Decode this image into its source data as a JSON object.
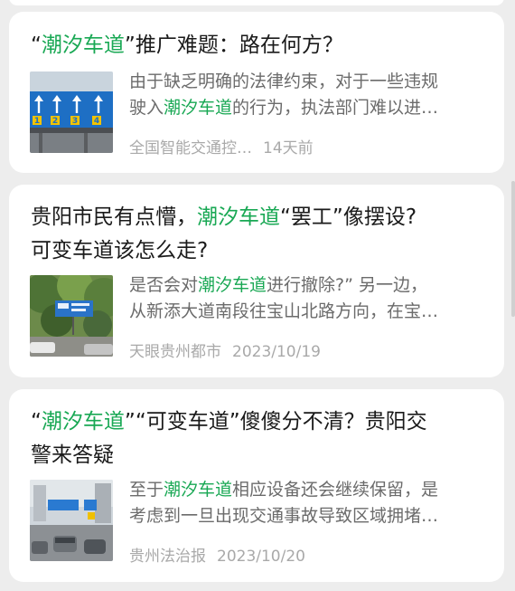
{
  "articles": [
    {
      "title": {
        "pre": "“",
        "hl": "潮汐车道",
        "post": "”推广难题：路在何方？",
        "line2": ""
      },
      "snippet": {
        "line1_pre": "由于缺乏明确的法律约束，对于一些违规",
        "line1_hl": "",
        "line1_post": "",
        "line2_pre": "驶入",
        "line2_hl": "潮汐车道",
        "line2_post": "的行为，执法部门难以进…"
      },
      "source": "全国智能交通控…",
      "date": "14天前",
      "thumb_text": [
        "1",
        "2",
        "3",
        "4"
      ]
    },
    {
      "title": {
        "pre": "贵阳市民有点懵，",
        "hl": "潮汐车道",
        "post": "“罢工”像摆设?",
        "line2": "可变车道该怎么走?"
      },
      "snippet": {
        "line1_pre": "是否会对",
        "line1_hl": "潮汐车道",
        "line1_post": "进行撤除?” 另一边，",
        "line2_pre": "从新添大道南段往宝山北路方向，在宝…",
        "line2_hl": "",
        "line2_post": ""
      },
      "source": "天眼贵州都市",
      "date": "2023/10/19"
    },
    {
      "title": {
        "pre": "“",
        "hl": "潮汐车道",
        "post": "”“可变车道”傻傻分不清？贵阳交",
        "line2": "警来答疑"
      },
      "snippet": {
        "line1_pre": "至于",
        "line1_hl": "潮汐车道",
        "line1_post": "相应设备还会继续保留，是",
        "line2_pre": "考虑到一旦出现交通事故导致区域拥堵…",
        "line2_hl": "",
        "line2_post": ""
      },
      "source": "贵州法治报",
      "date": "2023/10/20"
    }
  ],
  "colors": {
    "highlight": "#19a854",
    "title": "#1a1a1a",
    "snippet": "#6b6b6b",
    "meta": "#a9a9a9",
    "card_bg": "#ffffff",
    "page_bg": "#ededed"
  }
}
